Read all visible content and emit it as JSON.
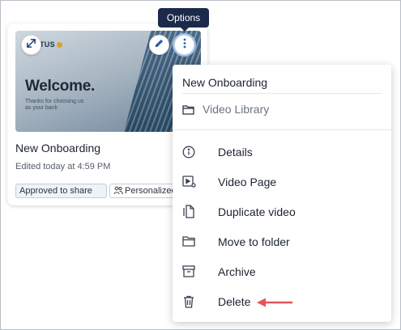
{
  "tooltip": {
    "text": "Options"
  },
  "card": {
    "thumbnail": {
      "logo_text": "TUS",
      "headline": "Welcome.",
      "tagline": "Thanks for choosing us as your bank"
    },
    "title": "New Onboarding",
    "edited": "Edited today at 4:59 PM",
    "tags": {
      "approved": "Approved to share",
      "personalized": "Personalized"
    }
  },
  "menu": {
    "title": "New Onboarding",
    "folder": "Video Library",
    "items": [
      {
        "label": "Details",
        "icon": "info-icon"
      },
      {
        "label": "Video Page",
        "icon": "video-page-icon"
      },
      {
        "label": "Duplicate video",
        "icon": "duplicate-icon"
      },
      {
        "label": "Move to folder",
        "icon": "folder-icon"
      },
      {
        "label": "Archive",
        "icon": "archive-icon"
      },
      {
        "label": "Delete",
        "icon": "trash-icon"
      }
    ]
  },
  "colors": {
    "tooltip_bg": "#1b2a4a",
    "edit_accent": "#2d5fb4",
    "arrow": "#e0545e"
  }
}
